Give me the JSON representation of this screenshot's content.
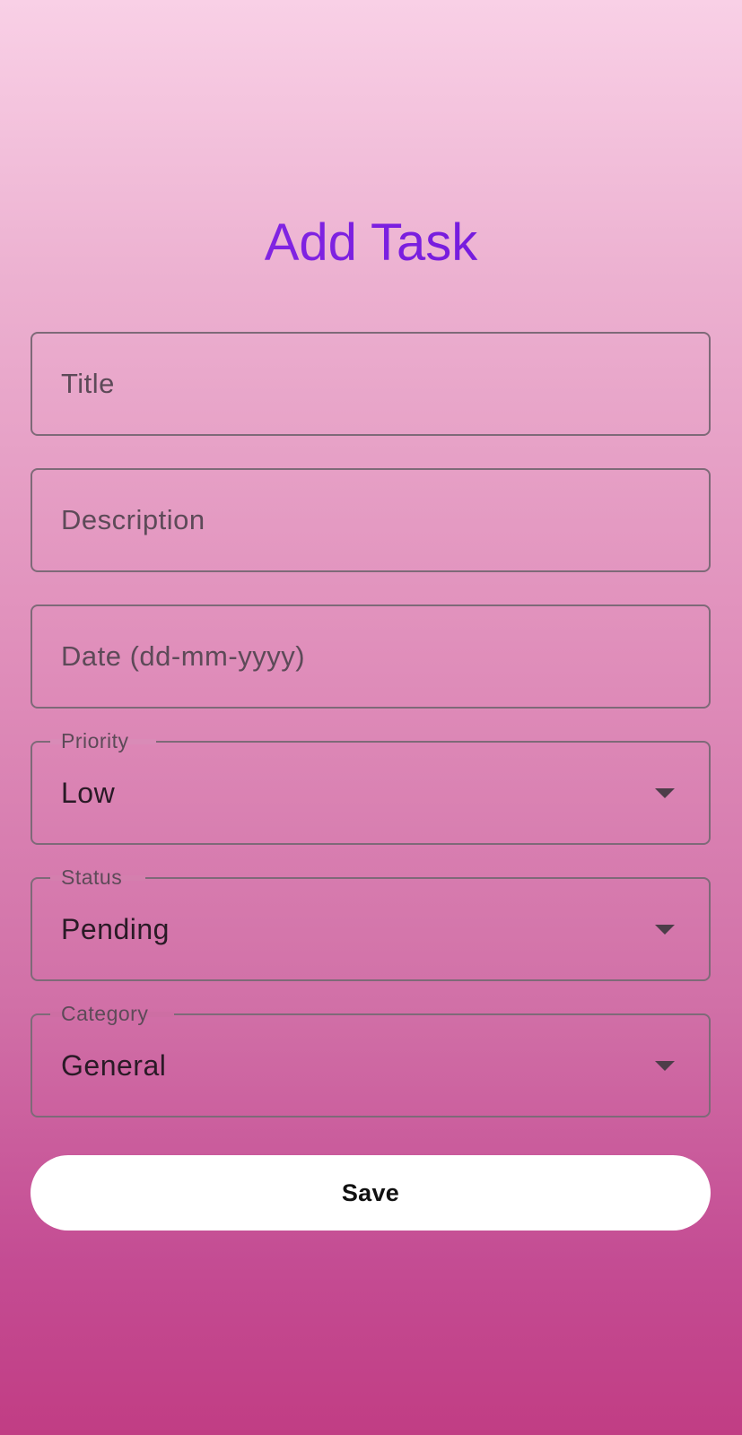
{
  "header": {
    "title": "Add Task"
  },
  "form": {
    "title_field": {
      "placeholder": "Title",
      "value": ""
    },
    "description_field": {
      "placeholder": "Description",
      "value": ""
    },
    "date_field": {
      "placeholder": "Date (dd-mm-yyyy)",
      "value": ""
    },
    "priority": {
      "label": "Priority",
      "selected": "Low"
    },
    "status": {
      "label": "Status",
      "selected": "Pending"
    },
    "category": {
      "label": "Category",
      "selected": "General"
    },
    "save_label": "Save"
  },
  "icons": {
    "dropdown": "chevron-down-icon"
  },
  "colors": {
    "title_gradient_start": "#8f2ee8",
    "title_gradient_end": "#6811d8",
    "background_top": "#f9d0e6",
    "background_bottom": "#c13d84",
    "field_border": "#7e6a78",
    "button_background": "#ffffff"
  }
}
